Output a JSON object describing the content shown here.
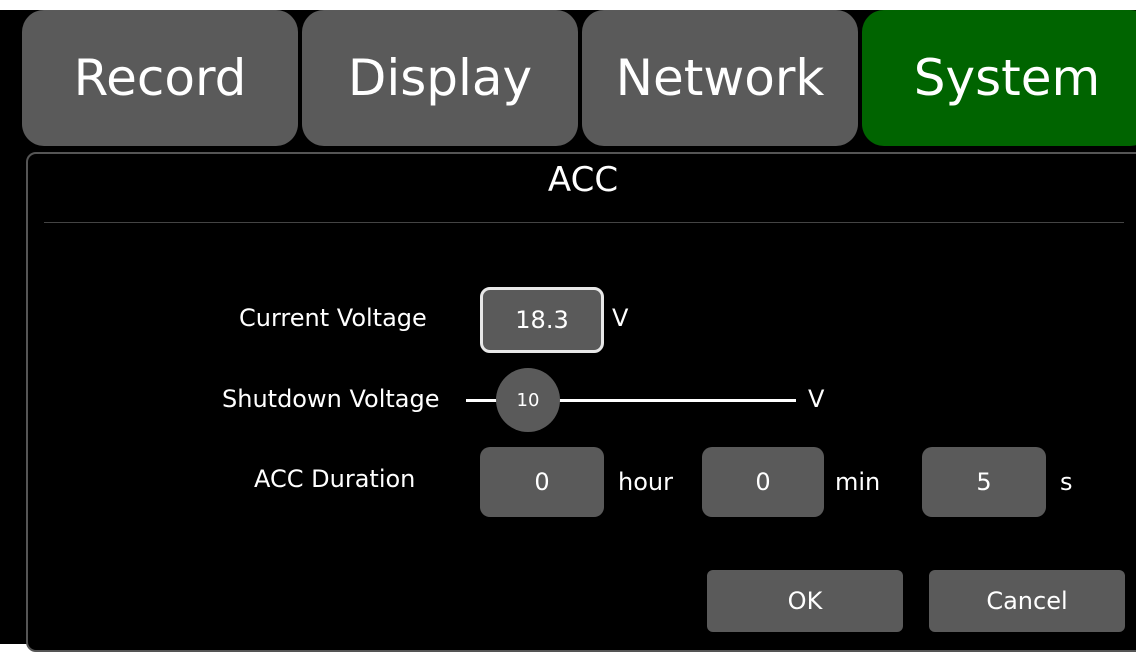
{
  "tabs": [
    {
      "label": "Record",
      "active": false
    },
    {
      "label": "Display",
      "active": false
    },
    {
      "label": "Network",
      "active": false
    },
    {
      "label": "System",
      "active": true
    }
  ],
  "colors": {
    "tab_default": "#5a5a5a",
    "tab_active": "#006400",
    "background": "#000000",
    "control": "#5a5a5a"
  },
  "dialog": {
    "title": "ACC",
    "current_voltage": {
      "label": "Current Voltage",
      "value": "18.3",
      "unit": "V"
    },
    "shutdown_voltage": {
      "label": "Shutdown Voltage",
      "value": "10",
      "unit": "V"
    },
    "acc_duration": {
      "label": "ACC Duration",
      "hour_value": "0",
      "hour_unit": "hour",
      "min_value": "0",
      "min_unit": "min",
      "sec_value": "5",
      "sec_unit": "s"
    },
    "ok_label": "OK",
    "cancel_label": "Cancel"
  }
}
